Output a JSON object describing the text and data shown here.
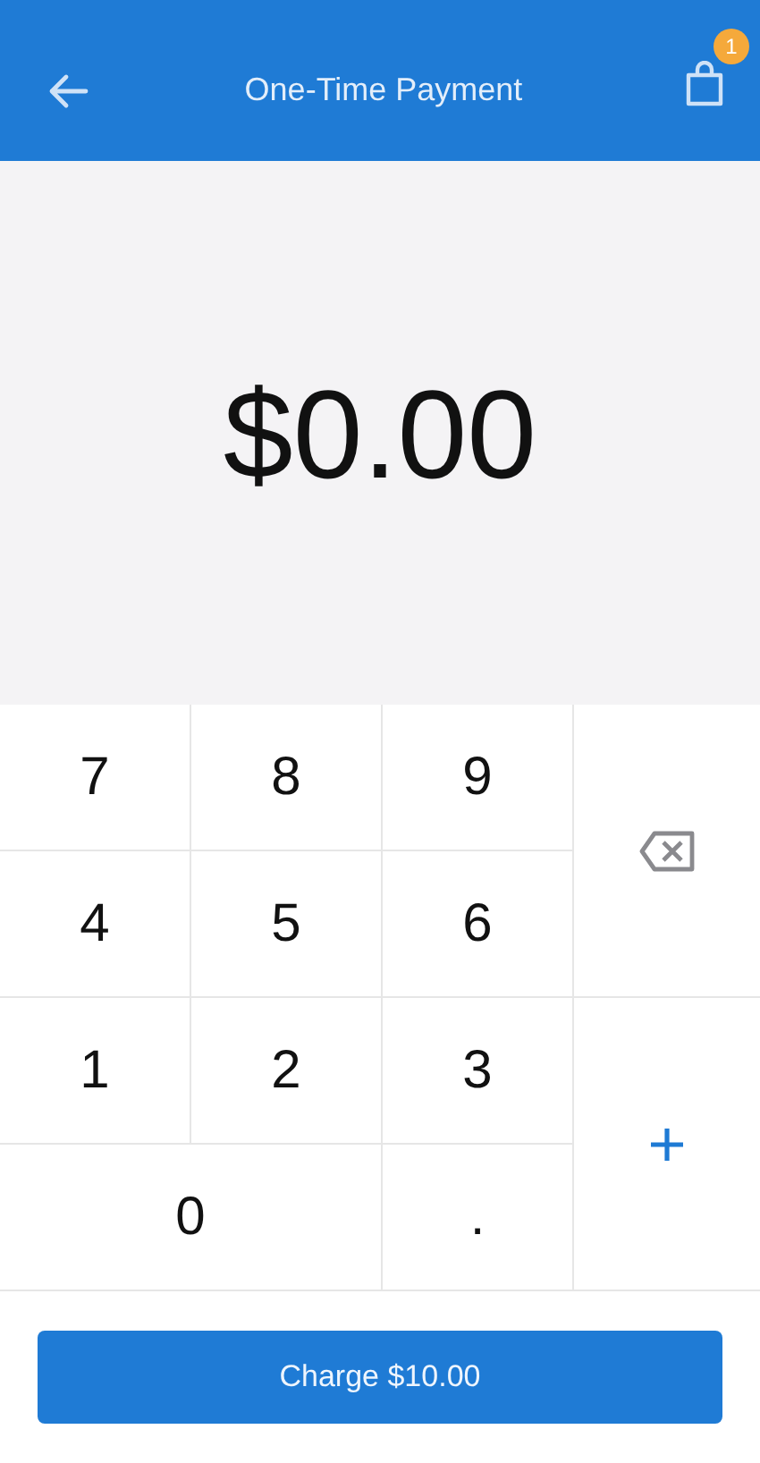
{
  "header": {
    "title": "One-Time Payment",
    "cart_badge": "1"
  },
  "amount": "$0.00",
  "keypad": [
    [
      "7",
      "8",
      "9"
    ],
    [
      "4",
      "5",
      "6"
    ],
    [
      "1",
      "2",
      "3"
    ],
    [
      "0",
      "."
    ]
  ],
  "charge_button": "Charge $10.00"
}
